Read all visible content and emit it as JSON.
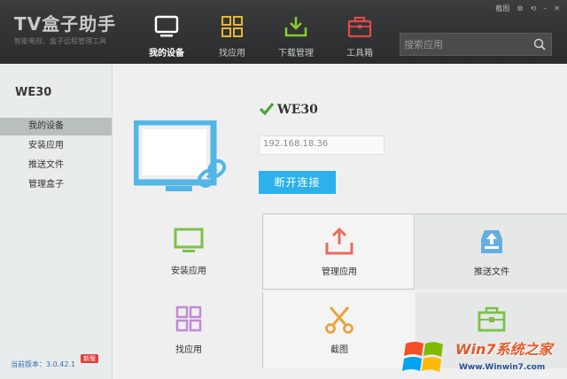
{
  "app": {
    "logo": "TV盒子助手",
    "slogan": "智能电视、盒子远程管理工具"
  },
  "window_controls": {
    "screenshot": "截图",
    "settings": "⚙",
    "refresh": "⟲",
    "minimize": "–",
    "close": "✕"
  },
  "nav": [
    {
      "label": "我的设备",
      "icon": "monitor-icon",
      "active": true
    },
    {
      "label": "找应用",
      "icon": "grid-icon"
    },
    {
      "label": "下载管理",
      "icon": "download-icon"
    },
    {
      "label": "工具箱",
      "icon": "toolbox-icon"
    }
  ],
  "search": {
    "placeholder": "搜索应用"
  },
  "sidebar": {
    "device_title": "WE30",
    "items": [
      {
        "label": "我的设备",
        "active": true
      },
      {
        "label": "安装应用"
      },
      {
        "label": "推送文件"
      },
      {
        "label": "管理盒子"
      }
    ],
    "version": "当前版本：3.0.42.1",
    "new_badge": "新版"
  },
  "device": {
    "name": "WE30",
    "ip": "192.168.18.36",
    "disconnect_label": "断开连接"
  },
  "tiles": [
    {
      "label": "安装应用",
      "icon": "install-tv-icon"
    },
    {
      "label": "管理应用",
      "icon": "upload-tray-icon"
    },
    {
      "label": "推送文件",
      "icon": "inbox-push-icon"
    },
    {
      "label": "找应用",
      "icon": "app-grid-icon"
    },
    {
      "label": "截图",
      "icon": "scissors-icon"
    },
    {
      "label": "",
      "icon": "toolbox-icon"
    }
  ],
  "watermark": {
    "title": "Win7系统之家",
    "url": "Www.Winwin7.com"
  },
  "colors": {
    "accent": "#2cb1ec",
    "topbar": "#2f3032",
    "sidebar_active": "#b9bebf",
    "check": "#4aa83a",
    "version_link": "#2b6fb4"
  }
}
